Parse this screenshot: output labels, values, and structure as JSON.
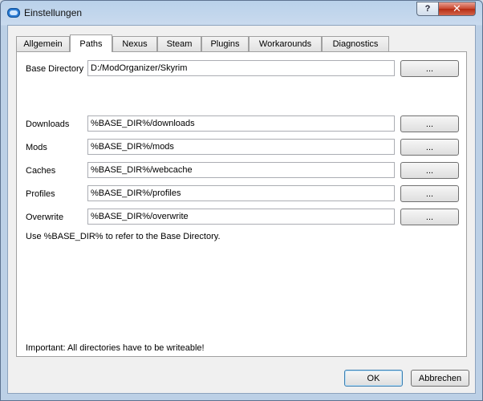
{
  "window": {
    "title": "Einstellungen",
    "help_label": "?",
    "close_label": "✕"
  },
  "tabs": [
    {
      "label": "Allgemein"
    },
    {
      "label": "Paths"
    },
    {
      "label": "Nexus"
    },
    {
      "label": "Steam"
    },
    {
      "label": "Plugins"
    },
    {
      "label": "Workarounds"
    },
    {
      "label": "Diagnostics"
    }
  ],
  "paths": {
    "base": {
      "label": "Base Directory",
      "value": "D:/ModOrganizer/Skyrim",
      "browse": "..."
    },
    "downloads": {
      "label": "Downloads",
      "value": "%BASE_DIR%/downloads",
      "browse": "..."
    },
    "mods": {
      "label": "Mods",
      "value": "%BASE_DIR%/mods",
      "browse": "..."
    },
    "caches": {
      "label": "Caches",
      "value": "%BASE_DIR%/webcache",
      "browse": "..."
    },
    "profiles": {
      "label": "Profiles",
      "value": "%BASE_DIR%/profiles",
      "browse": "..."
    },
    "overwrite": {
      "label": "Overwrite",
      "value": "%BASE_DIR%/overwrite",
      "browse": "..."
    },
    "hint": "Use %BASE_DIR% to refer to the Base Directory.",
    "important": "Important: All directories have to be writeable!"
  },
  "buttons": {
    "ok": "OK",
    "cancel": "Abbrechen"
  },
  "colors": {
    "title_bg": "#b9d1ea",
    "close_red": "#c9472f",
    "ok_border": "#3c7fb1"
  },
  "icons": {
    "app": "mod-organizer-icon"
  }
}
